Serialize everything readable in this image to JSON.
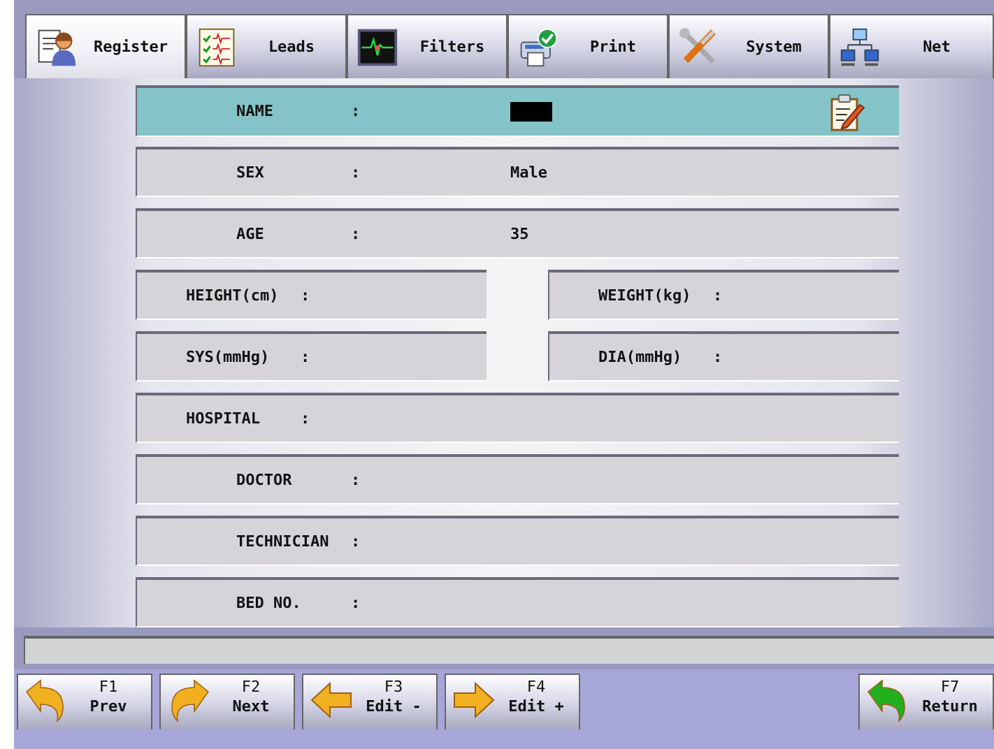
{
  "tabs": [
    {
      "label": "Register",
      "selected": true
    },
    {
      "label": "Leads",
      "selected": false
    },
    {
      "label": "Filters",
      "selected": false
    },
    {
      "label": "Print",
      "selected": false
    },
    {
      "label": "System",
      "selected": false
    },
    {
      "label": "Net",
      "selected": false
    }
  ],
  "rows": [
    {
      "kind": "sub",
      "fields": [
        {
          "label": "NAME",
          "separator": ":",
          "selected": true,
          "editing": true
        }
      ]
    },
    {
      "kind": "sub",
      "fields": [
        {
          "label": "SEX",
          "separator": ":",
          "value": "Male",
          "selected": false,
          "editing": false
        }
      ]
    },
    {
      "kind": "sub",
      "fields": [
        {
          "label": "AGE",
          "separator": ":",
          "value": "35",
          "selected": false,
          "editing": false
        }
      ]
    },
    {
      "kind": "pair",
      "fields": [
        {
          "label": "HEIGHT(cm)",
          "separator": ":",
          "selected": false,
          "editing": false
        },
        {
          "label": "WEIGHT(kg)",
          "separator": ":",
          "selected": false,
          "editing": false
        }
      ]
    },
    {
      "kind": "pair",
      "fields": [
        {
          "label": "SYS(mmHg)",
          "separator": ":",
          "selected": false,
          "editing": false
        },
        {
          "label": "DIA(mmHg)",
          "separator": ":",
          "selected": false,
          "editing": false
        }
      ]
    },
    {
      "kind": "main",
      "fields": [
        {
          "label": "HOSPITAL",
          "separator": ":",
          "selected": false,
          "editing": false
        }
      ]
    },
    {
      "kind": "sub",
      "fields": [
        {
          "label": "DOCTOR",
          "separator": ":",
          "selected": false,
          "editing": false
        }
      ]
    },
    {
      "kind": "sub",
      "fields": [
        {
          "label": "TECHNICIAN",
          "separator": ":",
          "selected": false,
          "editing": false
        }
      ]
    },
    {
      "kind": "sub",
      "fields": [
        {
          "label": "BED NO.",
          "separator": ":",
          "selected": false,
          "editing": false
        }
      ]
    }
  ],
  "function_keys": [
    {
      "key": "F1",
      "label": "Prev"
    },
    {
      "key": "F2",
      "label": "Next"
    },
    {
      "key": "F3",
      "label": "Edit -"
    },
    {
      "key": "F4",
      "label": "Edit +"
    },
    {
      "key": "F7",
      "label": "Return"
    }
  ]
}
